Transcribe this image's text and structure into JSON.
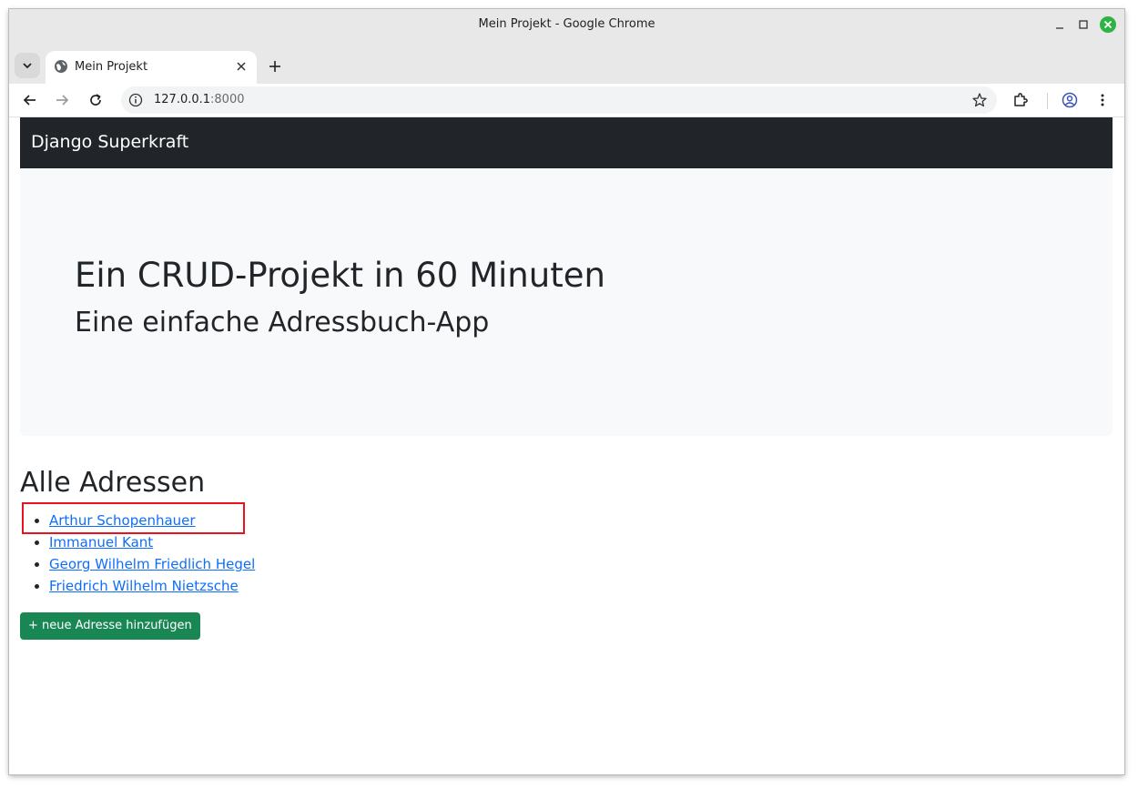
{
  "browser": {
    "window_title": "Mein Projekt - Google Chrome",
    "tab_title": "Mein Projekt",
    "url_host": "127.0.0.1",
    "url_port": ":8000"
  },
  "page": {
    "navbar_brand": "Django Superkraft",
    "hero_title": "Ein CRUD-Projekt in 60 Minuten",
    "hero_subtitle": "Eine einfache Adressbuch-App",
    "list_heading": "Alle Adressen",
    "addresses": [
      "Arthur Schopenhauer",
      "Immanuel Kant",
      "Georg Wilhelm Friedlich Hegel",
      "Friedrich Wilhelm Nietzsche"
    ],
    "add_button_label": "+ neue Adresse hinzufügen"
  },
  "colors": {
    "navbar_bg": "#212529",
    "hero_bg": "#f8f9fa",
    "link": "#0d6efd",
    "button_success": "#198754",
    "highlight": "#e8131c"
  }
}
